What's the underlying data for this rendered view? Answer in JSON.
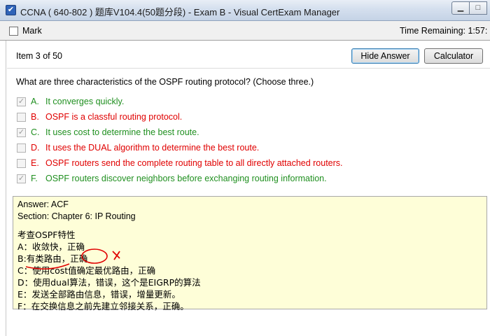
{
  "window": {
    "title": "CCNA ( 640-802 ) 题库V104.4(50题分段) - Exam B - Visual CertExam Manager",
    "minimize_glyph": "▁",
    "maximize_glyph": "□",
    "close_glyph": "✕"
  },
  "toolbar": {
    "mark_label": "Mark",
    "time_remaining": "Time Remaining: 1:57:"
  },
  "item": {
    "counter": "Item 3 of 50",
    "hide_answer_label": "Hide Answer",
    "calculator_label": "Calculator"
  },
  "question": "What are three characteristics of the OSPF routing protocol? (Choose three.)",
  "options": [
    {
      "letter": "A.",
      "text": "It converges quickly.",
      "checked": true,
      "status": "correct"
    },
    {
      "letter": "B.",
      "text": "OSPF is a classful routing protocol.",
      "checked": false,
      "status": "wrong"
    },
    {
      "letter": "C.",
      "text": "It uses cost to determine the best route.",
      "checked": true,
      "status": "correct"
    },
    {
      "letter": "D.",
      "text": "It uses the DUAL algorithm to determine the best route.",
      "checked": false,
      "status": "wrong"
    },
    {
      "letter": "E.",
      "text": "OSPF routers send the complete routing table to all directly attached routers.",
      "checked": false,
      "status": "wrong"
    },
    {
      "letter": "F.",
      "text": "OSPF routers discover neighbors before exchanging routing information.",
      "checked": true,
      "status": "correct"
    }
  ],
  "answer": {
    "answer_line": "Answer: ACF",
    "section_line": "Section: Chapter 6: IP Routing",
    "notes": [
      "考查OSPF特性",
      "A：收敛快，正确",
      "B:有类路由，正确",
      "C：使用cost值确定最优路由，正确",
      "D：使用dual算法，错误，这个是EIGRP的算法",
      "E：发送全部路由信息，错误，增量更新。",
      "F：在交换信息之前先建立邻接关系，正确。"
    ]
  },
  "colors": {
    "correct": "#1f8f1f",
    "wrong": "#e00000",
    "answer_bg": "#fefed8",
    "annotation": "#e00000"
  }
}
